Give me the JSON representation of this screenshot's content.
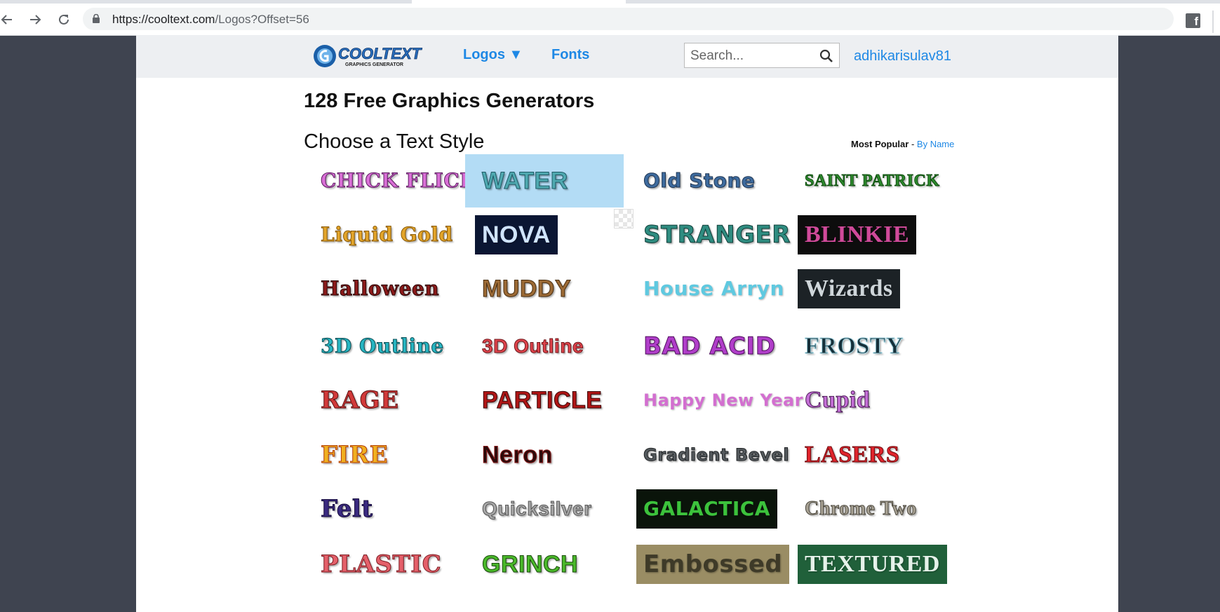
{
  "browser": {
    "url_host": "https://cooltext.com",
    "url_path": "/Logos?Offset=56"
  },
  "header": {
    "logo_main": "COOLTEXT",
    "logo_sub": "GRAPHICS GENERATOR",
    "nav_logos": "Logos ▼",
    "nav_fonts": "Fonts",
    "search_placeholder": "Search...",
    "username": "adhikarisulav81"
  },
  "main": {
    "title": "128 Free Graphics Generators",
    "subtitle": "Choose a Text Style",
    "sort_label": "Most Popular",
    "sort_separator": " - ",
    "sort_link": "By Name"
  },
  "styles": [
    {
      "label": "CHICK FLICK",
      "color": "#d96fd6",
      "bg": "",
      "stroke": "#5a1a5e"
    },
    {
      "label": "WATER",
      "color": "#4fa9b0",
      "bg": "",
      "stroke": "#1e5a66"
    },
    {
      "label": "Old Stone",
      "color": "#3e6b9e",
      "bg": "",
      "stroke": "#1f3552"
    },
    {
      "label": "SAINT PATRICK",
      "color": "#2e8b2e",
      "bg": "",
      "stroke": "#0f4d0f"
    },
    {
      "label": "Liquid Gold",
      "color": "#e3a52a",
      "bg": "",
      "stroke": "#8a5a08"
    },
    {
      "label": "NOVA",
      "color": "#d0e4ff",
      "bg": "#0b1633",
      "stroke": ""
    },
    {
      "label": "STRANGER",
      "color": "#2f8c80",
      "bg": "",
      "stroke": "#0e3b36"
    },
    {
      "label": "BLINKIE",
      "color": "#d04a9a",
      "bg": "#0d0d0d",
      "stroke": ""
    },
    {
      "label": "Halloween",
      "color": "#8a1a1a",
      "bg": "",
      "stroke": "#2a0505"
    },
    {
      "label": "MUDDY",
      "color": "#9c6a35",
      "bg": "",
      "stroke": "#4a2e10"
    },
    {
      "label": "House Arryn",
      "color": "#5fc9e0",
      "bg": "",
      "stroke": ""
    },
    {
      "label": "Wizards",
      "color": "#cfd6da",
      "bg": "#1c2226",
      "stroke": ""
    },
    {
      "label": "3D Outline",
      "color": "#27b5c2",
      "bg": "",
      "stroke": "#0b4d54"
    },
    {
      "label": "3D Outline",
      "color": "#e0444c",
      "bg": "",
      "stroke": "#6e1418"
    },
    {
      "label": "BAD ACID",
      "color": "#b03ec9",
      "bg": "",
      "stroke": "#4b0a5a"
    },
    {
      "label": "FROSTY",
      "color": "#16303a",
      "bg": "",
      "stroke": "#9fd3e0"
    },
    {
      "label": "RAGE",
      "color": "#d13a3a",
      "bg": "",
      "stroke": "#5a0f0f"
    },
    {
      "label": "PARTICLE",
      "color": "#b01616",
      "bg": "",
      "stroke": "#3a0505"
    },
    {
      "label": "Happy New Year",
      "color": "#d36fd0",
      "bg": "",
      "stroke": ""
    },
    {
      "label": "Cupid",
      "color": "#c46fd6",
      "bg": "",
      "stroke": "#4a1a55"
    },
    {
      "label": "FIRE",
      "color": "#f0b020",
      "bg": "",
      "stroke": "#b03a08"
    },
    {
      "label": "Neron",
      "color": "#2a0a0a",
      "bg": "",
      "stroke": "#8a1a1a"
    },
    {
      "label": "Gradient Bevel",
      "color": "#555a5e",
      "bg": "",
      "stroke": "#1f2224"
    },
    {
      "label": "LASERS",
      "color": "#e0242c",
      "bg": "",
      "stroke": "#6e0a0e"
    },
    {
      "label": "Felt",
      "color": "#3a2a80",
      "bg": "",
      "stroke": "#14093a"
    },
    {
      "label": "Quicksilver",
      "color": "#a8a8a8",
      "bg": "",
      "stroke": "#555555"
    },
    {
      "label": "GALACTICA",
      "color": "#3cc23c",
      "bg": "#0a140a",
      "stroke": ""
    },
    {
      "label": "Chrome Two",
      "color": "#a8a294",
      "bg": "",
      "stroke": "#4e4a40"
    },
    {
      "label": "PLASTIC",
      "color": "#e4606a",
      "bg": "",
      "stroke": "#7a1a20"
    },
    {
      "label": "GRINCH",
      "color": "#4ab82a",
      "bg": "",
      "stroke": "#174a09"
    },
    {
      "label": "Embossed",
      "color": "#3e3a28",
      "bg": "#9a8d64",
      "stroke": ""
    },
    {
      "label": "TEXTURED",
      "color": "#e6f2ea",
      "bg": "#20603a",
      "stroke": ""
    }
  ]
}
